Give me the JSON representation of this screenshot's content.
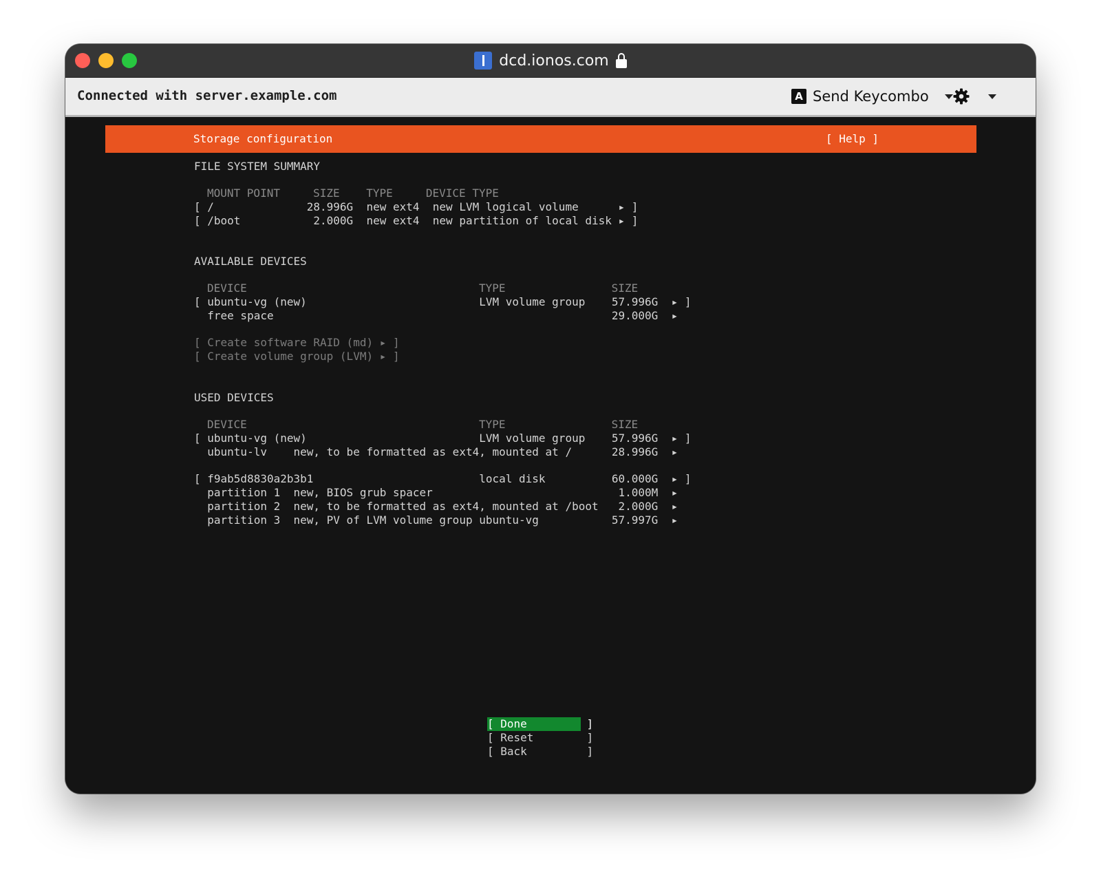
{
  "window": {
    "url": "dcd.ionos.com",
    "connection_text": "Connected with server.example.com",
    "send_keycombo_label": "Send Keycombo",
    "key_icon_letter": "A"
  },
  "installer": {
    "header_title": "Storage configuration",
    "help_label": "[ Help ]",
    "file_system_summary": {
      "heading": "FILE SYSTEM SUMMARY",
      "columns_line": "MOUNT POINT     SIZE    TYPE     DEVICE TYPE",
      "rows": [
        "[ /              28.996G  new ext4  new LVM logical volume      ▸ ]",
        "[ /boot           2.000G  new ext4  new partition of local disk ▸ ]"
      ]
    },
    "available_devices": {
      "heading": "AVAILABLE DEVICES",
      "columns_line": "DEVICE                                   TYPE                SIZE",
      "rows": [
        "[ ubuntu-vg (new)                          LVM volume group    57.996G  ▸ ]",
        "  free space                                                   29.000G  ▸"
      ],
      "actions": [
        "[ Create software RAID (md) ▸ ]",
        "[ Create volume group (LVM) ▸ ]"
      ]
    },
    "used_devices": {
      "heading": "USED DEVICES",
      "columns_line": "DEVICE                                   TYPE                SIZE",
      "rows": [
        "[ ubuntu-vg (new)                          LVM volume group    57.996G  ▸ ]",
        "  ubuntu-lv    new, to be formatted as ext4, mounted at /      28.996G  ▸",
        "[ f9ab5d8830a2b3b1                         local disk          60.000G  ▸ ]",
        "  partition 1  new, BIOS grub spacer                            1.000M  ▸",
        "  partition 2  new, to be formatted as ext4, mounted at /boot   2.000G  ▸",
        "  partition 3  new, PV of LVM volume group ubuntu-vg           57.997G  ▸"
      ]
    },
    "buttons": {
      "done": "[ Done         ]",
      "reset": "[ Reset        ]",
      "back": "[ Back         ]"
    }
  },
  "colors": {
    "header_orange": "#e95420",
    "done_green": "#12882e",
    "terminal_bg": "#141414"
  }
}
